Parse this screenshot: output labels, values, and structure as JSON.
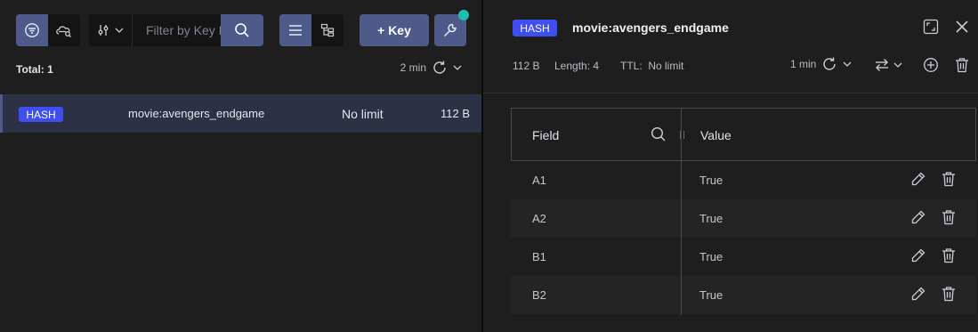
{
  "toolbar": {
    "filter_placeholder": "Filter by Key Name or Pattern",
    "add_key_label": "+ Key"
  },
  "key_list": {
    "total_label": "Total: 1",
    "refresh_label": "2 min",
    "rows": [
      {
        "type": "HASH",
        "name": "movie:avengers_endgame",
        "ttl": "No limit",
        "size": "112 B"
      }
    ]
  },
  "detail": {
    "type": "HASH",
    "key_name": "movie:avengers_endgame",
    "size": "112 B",
    "length": "Length: 4",
    "ttl": "TTL:  No limit",
    "refresh_label": "1 min",
    "columns": {
      "field": "Field",
      "value": "Value"
    },
    "rows": [
      {
        "field": "A1",
        "value": "True"
      },
      {
        "field": "A2",
        "value": "True"
      },
      {
        "field": "B1",
        "value": "True"
      },
      {
        "field": "B2",
        "value": "True"
      }
    ]
  },
  "colors": {
    "accent": "#4d5a8a",
    "hash_badge": "#3f4ef0",
    "notification": "#1ebfae",
    "selected_row": "#2c3146"
  },
  "icons": [
    "filter-icon",
    "cloud-search-icon",
    "sliders-icon",
    "chevron-down-icon",
    "search-icon",
    "list-view-icon",
    "tree-view-icon",
    "wrench-icon",
    "refresh-icon",
    "maximize-icon",
    "close-icon",
    "format-swap-icon",
    "add-icon",
    "delete-icon",
    "edit-icon"
  ]
}
